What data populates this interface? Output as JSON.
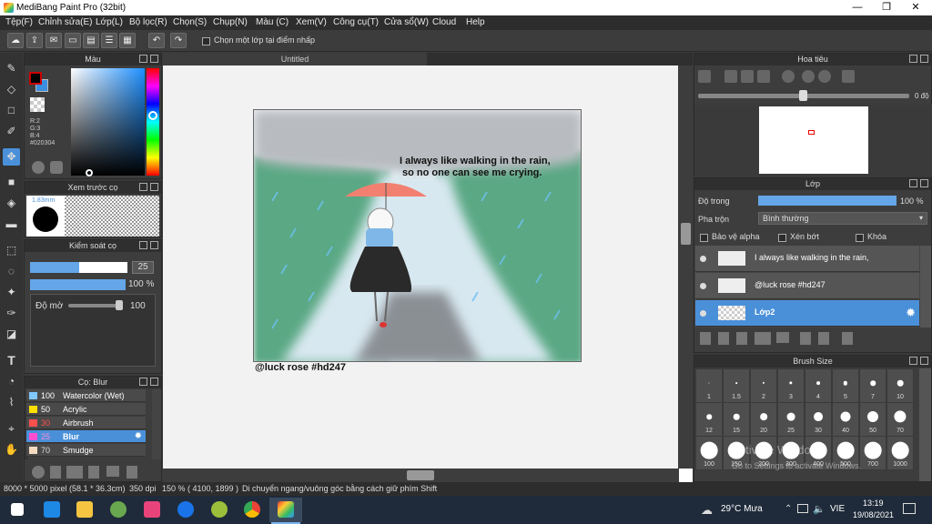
{
  "window": {
    "title": "MediBang Paint Pro (32bit)",
    "minimize": "—",
    "maximize": "❐",
    "close": "✕"
  },
  "menu": [
    "Tệp(F)",
    "Chỉnh sửa(E)",
    "Lớp(L)",
    "Bộ lọc(R)",
    "Chọn(S)",
    "Chụp(N)",
    "Màu (C)",
    "Xem(V)",
    "Công cụ(T)",
    "Cửa sổ(W)",
    "Cloud",
    "Help"
  ],
  "toolbar": {
    "checkbox_label": "Chọn một lớp tại điểm nhấp"
  },
  "color_panel": {
    "title": "Màu",
    "r": "R:2",
    "g": "G:3",
    "b": "B:4",
    "hex": "#020304",
    "fg_color": "#020304",
    "bg_color": "#3b8fe0"
  },
  "preview_panel": {
    "title": "Xem trước cọ",
    "size": "1.83mm"
  },
  "brush_control": {
    "title": "Kiểm soát cọ",
    "size_value": "25",
    "opacity_value": "100 %",
    "density_label": "Độ mờ",
    "density_value": "100",
    "size_fraction": 0.5,
    "opacity_fraction": 1.0,
    "density_fraction": 1.0
  },
  "brush_list": {
    "title": "Cọ: Blur",
    "items": [
      {
        "size": "100",
        "name": "Watercolor (Wet)",
        "color": "#7fc7ff"
      },
      {
        "size": "50",
        "name": "Acrylic",
        "color": "#ffe000"
      },
      {
        "size": "30",
        "name": "Airbrush",
        "color": "#ff5050"
      },
      {
        "size": "25",
        "name": "Blur",
        "color": "#ff4fd0"
      },
      {
        "size": "70",
        "name": "Smudge",
        "color": "#f5dcc0"
      }
    ]
  },
  "document": {
    "tab": "Untitled",
    "caption_line1": "I always  like walking in the rain,",
    "caption_line2": "so no one can see me crying.",
    "signature": "@luck rose #hd247"
  },
  "navigator": {
    "title": "Hoa tiêu",
    "angle": "0 độ"
  },
  "layers": {
    "title": "Lớp",
    "opacity_label": "Độ trong",
    "opacity_value": "100 %",
    "blend_label": "Pha trộn",
    "blend_value": "Bình thường",
    "protect_alpha": "Bảo vệ alpha",
    "clipping": "Xén bớt",
    "lock": "Khóa",
    "items": [
      {
        "name": "I always  like walking in the rain,"
      },
      {
        "name": "@luck rose #hd247"
      },
      {
        "name": "Lớp2"
      }
    ]
  },
  "brush_size": {
    "title": "Brush Size",
    "sizes": [
      "1",
      "1.5",
      "2",
      "3",
      "4",
      "5",
      "7",
      "10",
      "12",
      "15",
      "20",
      "25",
      "30",
      "40",
      "50",
      "70",
      "100",
      "150",
      "200",
      "300",
      "400",
      "500",
      "700",
      "1000"
    ]
  },
  "watermark": {
    "line1": "Activate Windows",
    "line2": "Go to Settings to activate Windows."
  },
  "status": {
    "dimensions": "8000 * 5000 pixel",
    "physical": "(58.1 * 36.3cm)",
    "dpi": "350 dpi",
    "zoom": "150 %",
    "coords": "( 4100, 1899 )",
    "hint": "Di chuyển ngang/vuông góc bằng cách giữ phím Shift"
  },
  "taskbar": {
    "weather": "29°C  Mưa",
    "lang": "VIE",
    "time": "13:19",
    "date": "19/08/2021"
  }
}
